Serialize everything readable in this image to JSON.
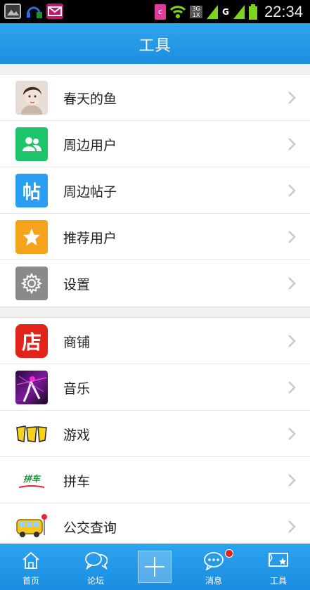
{
  "status_bar": {
    "time": "22:34",
    "network_label": "G",
    "network_small": "3G 1X"
  },
  "header": {
    "title": "工具"
  },
  "group1": [
    {
      "label": "春天的鱼",
      "icon": "user-avatar-icon"
    },
    {
      "label": "周边用户",
      "icon": "nearby-users-icon",
      "color": "#1cc46a"
    },
    {
      "label": "周边帖子",
      "icon": "nearby-posts-icon",
      "color": "#2a9df0",
      "icon_text": "帖"
    },
    {
      "label": "推荐用户",
      "icon": "star-icon",
      "color": "#f6a31c"
    },
    {
      "label": "设置",
      "icon": "gear-icon",
      "color": "#8a8a8a"
    }
  ],
  "group2": [
    {
      "label": "商铺",
      "icon": "shop-icon",
      "color": "#e2231a",
      "icon_text": "店"
    },
    {
      "label": "音乐",
      "icon": "music-icon"
    },
    {
      "label": "游戏",
      "icon": "game-icon"
    },
    {
      "label": "拼车",
      "icon": "carpool-icon",
      "icon_text": "拼车"
    },
    {
      "label": "公交查询",
      "icon": "bus-icon"
    }
  ],
  "tabbar": {
    "home": "首页",
    "forum": "论坛",
    "messages": "消息",
    "tools": "工具"
  }
}
